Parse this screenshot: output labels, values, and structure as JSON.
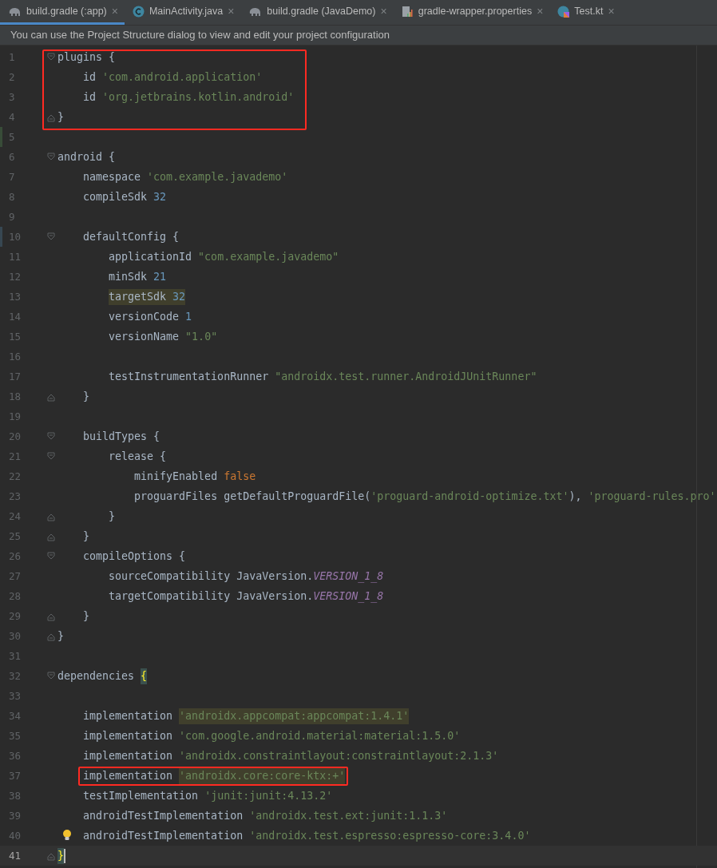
{
  "tabs": [
    {
      "label": "build.gradle (:app)",
      "kind": "gradle",
      "selected": true,
      "close": "×"
    },
    {
      "label": "MainActivity.java",
      "kind": "class",
      "selected": false,
      "close": "×"
    },
    {
      "label": "build.gradle (JavaDemo)",
      "kind": "gradle",
      "selected": false,
      "close": "×"
    },
    {
      "label": "gradle-wrapper.properties",
      "kind": "properties",
      "selected": false,
      "close": "×"
    },
    {
      "label": "Test.kt",
      "kind": "kotlin",
      "selected": false,
      "close": "×"
    }
  ],
  "banner": {
    "text": "You can use the Project Structure dialog to view and edit your project configuration"
  },
  "editor": {
    "lines": [
      {
        "number": "1",
        "current": false,
        "fold": {
          "kind": "open"
        },
        "annotation": {
          "kind": "box"
        },
        "tokens": [
          {
            "text": "plugins {",
            "kind": "plain",
            "highlighted": false
          }
        ],
        "children": [
          {
            "number": "2",
            "current": false,
            "annotation": {
              "kind": "box"
            },
            "tokens": [
              {
                "text": "id ",
                "kind": "plain",
                "highlighted": false
              },
              {
                "text": "'com.android.application'",
                "kind": "string",
                "highlighted": false
              }
            ]
          },
          {
            "number": "3",
            "current": false,
            "annotation": {
              "kind": "box"
            },
            "tokens": [
              {
                "text": "id ",
                "kind": "plain",
                "highlighted": false
              },
              {
                "text": "'org.jetbrains.kotlin.android'",
                "kind": "string",
                "highlighted": false
              }
            ]
          }
        ]
      },
      {
        "number": "4",
        "current": false,
        "fold": {
          "kind": "close"
        },
        "annotation": {
          "kind": "box"
        },
        "tokens": [
          {
            "text": "}",
            "kind": "plain",
            "highlighted": false
          }
        ]
      },
      {
        "number": "5",
        "current": false,
        "change": {
          "kind": "added"
        }
      },
      {
        "number": "6",
        "current": false,
        "fold": {
          "kind": "open"
        },
        "tokens": [
          {
            "text": "android {",
            "kind": "plain",
            "highlighted": false
          }
        ],
        "children": [
          {
            "number": "7",
            "current": false,
            "tokens": [
              {
                "text": "namespace ",
                "kind": "plain",
                "highlighted": false
              },
              {
                "text": "'com.example.javademo'",
                "kind": "string",
                "highlighted": false
              }
            ]
          },
          {
            "number": "8",
            "current": false,
            "tokens": [
              {
                "text": "compileSdk ",
                "kind": "plain",
                "highlighted": false
              },
              {
                "text": "32",
                "kind": "number",
                "highlighted": false
              }
            ]
          },
          {
            "number": "9",
            "current": false
          },
          {
            "number": "10",
            "current": false,
            "fold": {
              "kind": "open"
            },
            "change": {
              "kind": "modified"
            },
            "tokens": [
              {
                "text": "defaultConfig {",
                "kind": "plain",
                "highlighted": false
              }
            ],
            "children": [
              {
                "number": "11",
                "current": false,
                "tokens": [
                  {
                    "text": "applicationId ",
                    "kind": "plain",
                    "highlighted": false
                  },
                  {
                    "text": "\"com.example.javademo\"",
                    "kind": "string",
                    "highlighted": false
                  }
                ]
              },
              {
                "number": "12",
                "current": false,
                "tokens": [
                  {
                    "text": "minSdk ",
                    "kind": "plain",
                    "highlighted": false
                  },
                  {
                    "text": "21",
                    "kind": "number",
                    "highlighted": false
                  }
                ]
              },
              {
                "number": "13",
                "current": false,
                "tokens": [
                  {
                    "text": "targetSdk ",
                    "kind": "plain",
                    "highlighted": true
                  },
                  {
                    "text": "32",
                    "kind": "number",
                    "highlighted": true
                  }
                ]
              },
              {
                "number": "14",
                "current": false,
                "tokens": [
                  {
                    "text": "versionCode ",
                    "kind": "plain",
                    "highlighted": false
                  },
                  {
                    "text": "1",
                    "kind": "number",
                    "highlighted": false
                  }
                ]
              },
              {
                "number": "15",
                "current": false,
                "tokens": [
                  {
                    "text": "versionName ",
                    "kind": "plain",
                    "highlighted": false
                  },
                  {
                    "text": "\"1.0\"",
                    "kind": "string",
                    "highlighted": false
                  }
                ]
              },
              {
                "number": "16",
                "current": false
              },
              {
                "number": "17",
                "current": false,
                "tokens": [
                  {
                    "text": "testInstrumentationRunner ",
                    "kind": "plain",
                    "highlighted": false
                  },
                  {
                    "text": "\"androidx.test.runner.AndroidJUnitRunner\"",
                    "kind": "string",
                    "highlighted": false
                  }
                ]
              }
            ]
          },
          {
            "number": "18",
            "current": false,
            "fold": {
              "kind": "close"
            },
            "tokens": [
              {
                "text": "}",
                "kind": "plain",
                "highlighted": false
              }
            ]
          },
          {
            "number": "19",
            "current": false
          },
          {
            "number": "20",
            "current": false,
            "fold": {
              "kind": "open"
            },
            "tokens": [
              {
                "text": "buildTypes {",
                "kind": "plain",
                "highlighted": false
              }
            ],
            "children": [
              {
                "number": "21",
                "current": false,
                "fold": {
                  "kind": "open"
                },
                "tokens": [
                  {
                    "text": "release {",
                    "kind": "plain",
                    "highlighted": false
                  }
                ],
                "children": [
                  {
                    "number": "22",
                    "current": false,
                    "tokens": [
                      {
                        "text": "minifyEnabled ",
                        "kind": "plain",
                        "highlighted": false
                      },
                      {
                        "text": "false",
                        "kind": "keyword",
                        "highlighted": false
                      }
                    ]
                  },
                  {
                    "number": "23",
                    "current": false,
                    "tokens": [
                      {
                        "text": "proguardFiles getDefaultProguardFile(",
                        "kind": "plain",
                        "highlighted": false
                      },
                      {
                        "text": "'proguard-android-optimize.txt'",
                        "kind": "string",
                        "highlighted": false
                      },
                      {
                        "text": "), ",
                        "kind": "plain",
                        "highlighted": false
                      },
                      {
                        "text": "'proguard-rules.pro'",
                        "kind": "string",
                        "highlighted": false
                      }
                    ]
                  }
                ]
              },
              {
                "number": "24",
                "current": false,
                "fold": {
                  "kind": "close"
                },
                "tokens": [
                  {
                    "text": "}",
                    "kind": "plain",
                    "highlighted": false
                  }
                ]
              }
            ]
          },
          {
            "number": "25",
            "current": false,
            "fold": {
              "kind": "close"
            },
            "tokens": [
              {
                "text": "}",
                "kind": "plain",
                "highlighted": false
              }
            ]
          },
          {
            "number": "26",
            "current": false,
            "fold": {
              "kind": "open"
            },
            "tokens": [
              {
                "text": "compileOptions {",
                "kind": "plain",
                "highlighted": false
              }
            ],
            "children": [
              {
                "number": "27",
                "current": false,
                "tokens": [
                  {
                    "text": "sourceCompatibility JavaVersion.",
                    "kind": "plain",
                    "highlighted": false
                  },
                  {
                    "text": "VERSION_1_8",
                    "kind": "constant",
                    "highlighted": false
                  }
                ]
              },
              {
                "number": "28",
                "current": false,
                "tokens": [
                  {
                    "text": "targetCompatibility JavaVersion.",
                    "kind": "plain",
                    "highlighted": false
                  },
                  {
                    "text": "VERSION_1_8",
                    "kind": "constant",
                    "highlighted": false
                  }
                ]
              }
            ]
          },
          {
            "number": "29",
            "current": false,
            "fold": {
              "kind": "close"
            },
            "tokens": [
              {
                "text": "}",
                "kind": "plain",
                "highlighted": false
              }
            ]
          }
        ]
      },
      {
        "number": "30",
        "current": false,
        "fold": {
          "kind": "close"
        },
        "tokens": [
          {
            "text": "}",
            "kind": "plain",
            "highlighted": false
          }
        ]
      },
      {
        "number": "31",
        "current": false
      },
      {
        "number": "32",
        "current": false,
        "fold": {
          "kind": "open"
        },
        "tokens": [
          {
            "text": "dependencies ",
            "kind": "plain",
            "highlighted": false
          },
          {
            "text": "{",
            "kind": "brace",
            "highlighted": true
          }
        ],
        "children": [
          {
            "number": "33",
            "current": false
          },
          {
            "number": "34",
            "current": false,
            "tokens": [
              {
                "text": "implementation ",
                "kind": "plain",
                "highlighted": false
              },
              {
                "text": "'androidx.appcompat:appcompat:1.4.1'",
                "kind": "string",
                "highlighted": true
              }
            ]
          },
          {
            "number": "35",
            "current": false,
            "tokens": [
              {
                "text": "implementation ",
                "kind": "plain",
                "highlighted": false
              },
              {
                "text": "'com.google.android.material:material:1.5.0'",
                "kind": "string",
                "highlighted": false
              }
            ]
          },
          {
            "number": "36",
            "current": false,
            "tokens": [
              {
                "text": "implementation ",
                "kind": "plain",
                "highlighted": false
              },
              {
                "text": "'androidx.constraintlayout:constraintlayout:2.1.3'",
                "kind": "string",
                "highlighted": false
              }
            ]
          },
          {
            "number": "37",
            "current": false,
            "annotation": {
              "kind": "box"
            },
            "tokens": [
              {
                "text": "implementation ",
                "kind": "plain",
                "highlighted": false
              },
              {
                "text": "'androidx.core:core-ktx:+'",
                "kind": "string",
                "highlighted": true
              }
            ]
          },
          {
            "number": "38",
            "current": false,
            "tokens": [
              {
                "text": "testImplementation ",
                "kind": "plain",
                "highlighted": false
              },
              {
                "text": "'junit:junit:4.13.2'",
                "kind": "string",
                "highlighted": false
              }
            ]
          },
          {
            "number": "39",
            "current": false,
            "tokens": [
              {
                "text": "androidTestImplementation ",
                "kind": "plain",
                "highlighted": false
              },
              {
                "text": "'androidx.test.ext:junit:1.1.3'",
                "kind": "string",
                "highlighted": false
              }
            ]
          },
          {
            "number": "40",
            "current": false,
            "gutter_icon": {
              "kind": "lightbulb"
            },
            "tokens": [
              {
                "text": "androidTestImplementation ",
                "kind": "plain",
                "highlighted": false
              },
              {
                "text": "'androidx.test.espresso:espresso-core:3.4.0'",
                "kind": "string",
                "highlighted": false
              }
            ]
          }
        ]
      },
      {
        "number": "41",
        "current": true,
        "fold": {
          "kind": "close"
        },
        "tokens": [
          {
            "text": "}",
            "kind": "brace",
            "highlighted": true
          }
        ]
      }
    ]
  }
}
